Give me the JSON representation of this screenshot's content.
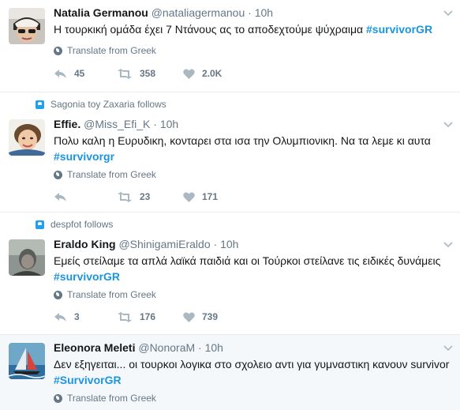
{
  "tweets": [
    {
      "context": "",
      "name": "Natalia Germanou",
      "handle": "@nataliagermanou",
      "time": "10h",
      "text": "Η τουρκική ομάδα έχει 7 Ντάνους ας το αποδεχτούμε ψύχραιμα",
      "hashtag": "#survivorGR",
      "translate": "Translate from Greek",
      "replies": "45",
      "retweets": "358",
      "likes": "2.0K"
    },
    {
      "context": "Sagonia toy Zaxaria follows",
      "name": "Effie.",
      "handle": "@Miss_Efi_K",
      "time": "10h",
      "text": "Πολυ καλη η Ευρυδικη, κονταρει στα ισα την Ολυμπιονικη. Να τα λεμε κι αυτα",
      "hashtag": "#survivorgr",
      "translate": "Translate from Greek",
      "replies": "",
      "retweets": "23",
      "likes": "171"
    },
    {
      "context": "despfot follows",
      "name": "Eraldo King",
      "handle": "@ShinigamiEraldo",
      "time": "10h",
      "text": "Εμείς στείλαμε τα απλά λαϊκά παιδιά και οι Τούρκοι στείλανε τις ειδικές δυνάμεις",
      "hashtag": "#survivorGR",
      "translate": "Translate from Greek",
      "replies": "3",
      "retweets": "176",
      "likes": "739"
    },
    {
      "context": "",
      "name": "Eleonora Meleti",
      "handle": "@NonoraM",
      "time": "10h",
      "text": "Δεν εξηγειται... οι τουρκοι λογικα στο σχολειο αντι για γυμναστικη κανουν survivor",
      "hashtag": "#SurvivorGR",
      "translate": "Translate from Greek",
      "replies": "",
      "retweets": "",
      "likes": ""
    }
  ],
  "separator": " · ",
  "colors": {
    "text": "#14171a",
    "muted": "#657786",
    "hashtag": "#1b95e0",
    "highlight_bg": "#f5f8fa",
    "border": "#e6ecf0"
  },
  "icons": [
    "follow-context-icon",
    "globe-icon",
    "reply-icon",
    "retweet-icon",
    "like-icon",
    "caret-down-icon"
  ]
}
